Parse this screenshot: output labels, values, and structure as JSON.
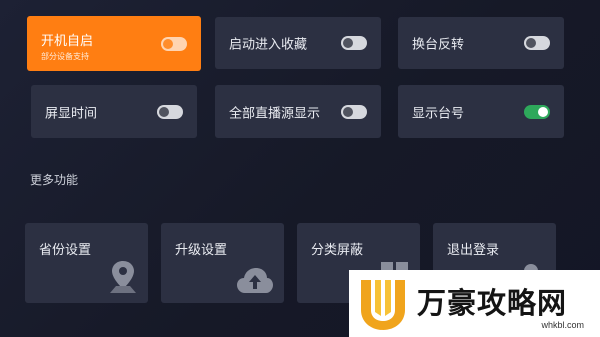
{
  "settings": [
    {
      "label": "开机自启",
      "sublabel": "部分设备支持",
      "on": false,
      "active": true
    },
    {
      "label": "启动进入收藏",
      "on": false
    },
    {
      "label": "换台反转",
      "on": false
    },
    {
      "label": "屏显时间",
      "on": false
    },
    {
      "label": "全部直播源显示",
      "on": false
    },
    {
      "label": "显示台号",
      "on": true
    }
  ],
  "more_section": {
    "title": "更多功能"
  },
  "features": [
    {
      "label": "省份设置",
      "icon": "map-pin-icon"
    },
    {
      "label": "升级设置",
      "icon": "cloud-upload-icon"
    },
    {
      "label": "分类屏蔽",
      "icon": "grid-icon"
    },
    {
      "label": "退出登录",
      "icon": "user-icon"
    }
  ],
  "watermark": {
    "title": "万豪攻略网",
    "url": "whkbl.com"
  },
  "colors": {
    "accent": "#ff7e12",
    "toggle_on": "#2ea85b",
    "tile": "#2c3042"
  }
}
